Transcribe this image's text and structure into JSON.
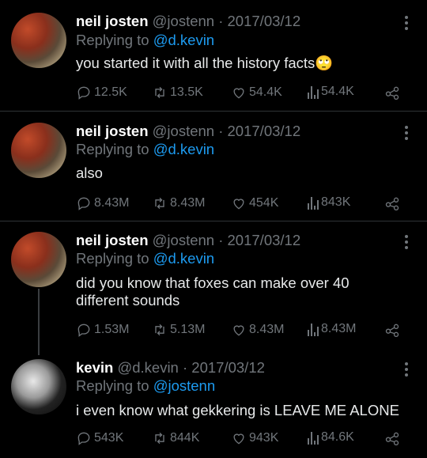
{
  "tweets": [
    {
      "name": "neil josten",
      "handle": "@jostenn",
      "date": "· 2017/03/12",
      "replying_prefix": "Replying to ",
      "replying_to": "@d.kevin",
      "text": "you started it with all the history facts🙄",
      "replies": "12.5K",
      "retweets": "13.5K",
      "likes": "54.4K",
      "views": "54.4K"
    },
    {
      "name": "neil josten",
      "handle": "@jostenn",
      "date": "· 2017/03/12",
      "replying_prefix": "Replying to ",
      "replying_to": "@d.kevin",
      "text": "also",
      "replies": "8.43M",
      "retweets": "8.43M",
      "likes": "454K",
      "views": "843K"
    },
    {
      "name": "neil josten",
      "handle": "@jostenn",
      "date": "· 2017/03/12",
      "replying_prefix": "Replying to ",
      "replying_to": "@d.kevin",
      "text": "did you know that foxes can make over 40 different sounds",
      "replies": "1.53M",
      "retweets": "5.13M",
      "likes": "8.43M",
      "views": "8.43M"
    },
    {
      "name": "kevin",
      "handle": "@d.kevin",
      "date": "· 2017/03/12",
      "replying_prefix": "Replying to ",
      "replying_to": "@jostenn",
      "text": "i even know what gekkering is LEAVE ME ALONE",
      "replies": "543K",
      "retweets": "844K",
      "likes": "943K",
      "views": "84.6K"
    }
  ],
  "colors": {
    "background": "#000000",
    "secondary_text": "#71767b",
    "mention": "#1d9bf0",
    "divider": "#2f3336"
  }
}
